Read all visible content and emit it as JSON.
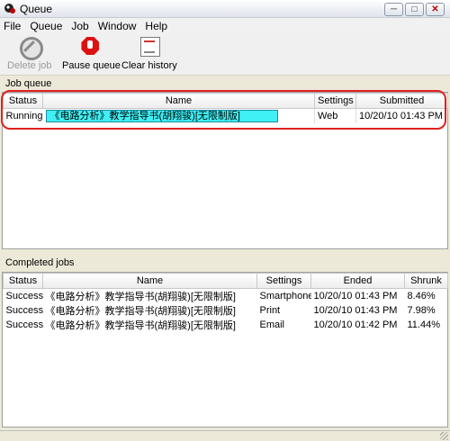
{
  "window": {
    "title": "Queue",
    "minimize": "─",
    "maximize": "□",
    "close": "✕"
  },
  "menu": [
    {
      "label": "File"
    },
    {
      "label": "Queue"
    },
    {
      "label": "Job"
    },
    {
      "label": "Window"
    },
    {
      "label": "Help"
    }
  ],
  "toolbar": {
    "delete_label": "Delete job",
    "pause_label": "Pause queue",
    "clear_label": "Clear history"
  },
  "job_queue": {
    "label": "Job queue",
    "columns": [
      "Status",
      "Name",
      "Settings",
      "Submitted"
    ],
    "rows": [
      {
        "status": "Running",
        "name": "《电路分析》教学指导书(胡翔骏)[无限制版]",
        "settings": "Web",
        "submitted": "10/20/10 01:43 PM"
      }
    ]
  },
  "completed_jobs": {
    "label": "Completed jobs",
    "columns": [
      "Status",
      "Name",
      "Settings",
      "Ended",
      "Shrunk"
    ],
    "rows": [
      {
        "status": "Success",
        "name": "《电路分析》教学指导书(胡翔骏)[无限制版]",
        "settings": "Smartphone",
        "ended": "10/20/10 01:43 PM",
        "shrunk": "8.46%"
      },
      {
        "status": "Success",
        "name": "《电路分析》教学指导书(胡翔骏)[无限制版]",
        "settings": "Print",
        "ended": "10/20/10 01:43 PM",
        "shrunk": "7.98%"
      },
      {
        "status": "Success",
        "name": "《电路分析》教学指导书(胡翔骏)[无限制版]",
        "settings": "Email",
        "ended": "10/20/10 01:42 PM",
        "shrunk": "11.44%"
      }
    ]
  },
  "colors": {
    "selection": "#3ff0f4",
    "highlight_oval": "#e02020"
  },
  "icons": {
    "delete": "delete-icon",
    "pause": "pause-stop-icon",
    "clear": "clear-history-icon"
  }
}
